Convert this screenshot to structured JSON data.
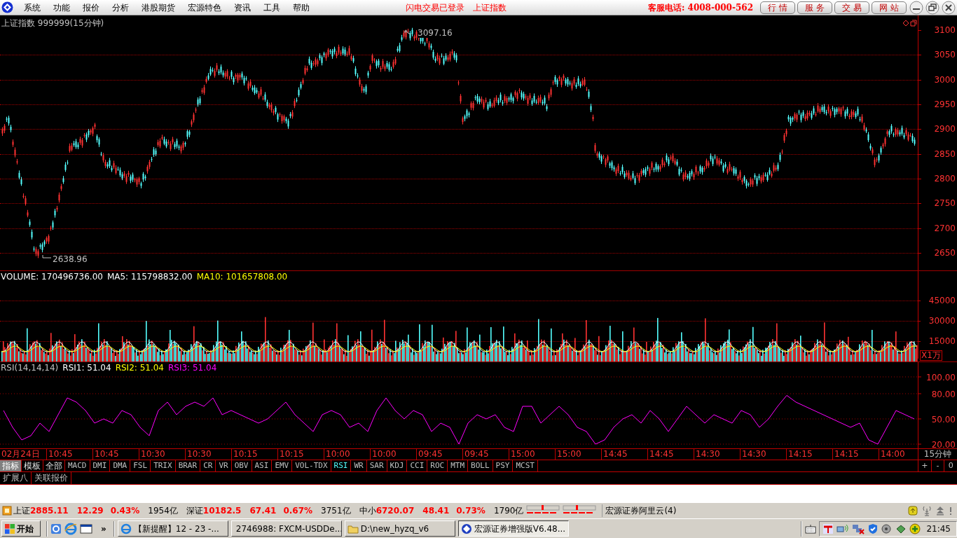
{
  "menu": {
    "items": [
      "系统",
      "功能",
      "报价",
      "分析",
      "港股期货",
      "宏源特色",
      "资讯",
      "工具",
      "帮助"
    ]
  },
  "login_status": "闪电交易已登录",
  "current_index": "上证指数",
  "hotline": "客服电话: 4008-000-562",
  "nav_buttons": [
    "行 情",
    "服 务",
    "交 易",
    "网 站"
  ],
  "price_panel": {
    "title": "上证指数 999999(15分钟)",
    "high_label": "3097.16",
    "low_label": "2638.96",
    "axis": [
      "3100",
      "3050",
      "3000",
      "2950",
      "2900",
      "2850",
      "2800",
      "2750",
      "2700",
      "2650"
    ]
  },
  "volume_panel": {
    "legend": [
      {
        "text": "VOLUME: 170496736.00",
        "color": "#ffffff"
      },
      {
        "text": "MA5: 115798832.00",
        "color": "#ffffff"
      },
      {
        "text": "MA10: 101657808.00",
        "color": "#ffff00"
      }
    ],
    "axis": [
      "45000",
      "30000",
      "15000"
    ],
    "unit": "X1万"
  },
  "rsi_panel": {
    "legend": [
      {
        "text": "RSI(14,14,14)",
        "color": "#c0c0c0"
      },
      {
        "text": "RSI1: 51.04",
        "color": "#ffffff"
      },
      {
        "text": "RSI2: 51.04",
        "color": "#ffff00"
      },
      {
        "text": "RSI3: 51.04",
        "color": "#ff00ff"
      }
    ],
    "chart_data": {
      "type": "line",
      "grid": true,
      "ylim": [
        15,
        117.5
      ],
      "yticks": [
        {
          "value": 100,
          "label": "100.00"
        },
        {
          "value": 80,
          "label": "80.00"
        },
        {
          "value": 50,
          "label": "50.00"
        },
        {
          "value": 20,
          "label": "20.00"
        }
      ],
      "series": [
        {
          "color": "#ff00ff",
          "values": [
            60,
            40,
            25,
            30,
            45,
            35,
            55,
            75,
            70,
            60,
            45,
            50,
            45,
            60,
            55,
            40,
            30,
            60,
            70,
            55,
            65,
            70,
            65,
            75,
            55,
            60,
            55,
            50,
            45,
            50,
            60,
            70,
            55,
            45,
            35,
            55,
            60,
            55,
            40,
            45,
            35,
            60,
            75,
            60,
            50,
            60,
            55,
            35,
            45,
            40,
            20,
            45,
            55,
            50,
            55,
            40,
            35,
            65,
            65,
            45,
            55,
            65,
            55,
            40,
            35,
            20,
            25,
            40,
            50,
            55,
            45,
            60,
            50,
            35,
            50,
            65,
            55,
            45,
            55,
            50,
            45,
            60,
            55,
            40,
            50,
            65,
            78,
            70,
            65,
            60,
            55,
            50,
            45,
            40,
            45,
            25,
            20,
            40,
            60,
            55,
            50
          ]
        }
      ]
    }
  },
  "time_axis": {
    "labels": [
      "02月24日",
      "10:45",
      "10:45",
      "10:30",
      "10:30",
      "10:15",
      "10:15",
      "10:00",
      "10:00",
      "09:45",
      "09:45",
      "15:00",
      "15:00",
      "14:45",
      "14:45",
      "14:30",
      "14:30",
      "14:15",
      "14:15",
      "14:00"
    ],
    "period": "15分钟"
  },
  "panel_buttons": [
    {
      "label": "指标",
      "selected": true
    },
    {
      "label": "模板",
      "selected": false
    },
    {
      "label": "全部",
      "selected": false
    }
  ],
  "indicators": [
    {
      "label": "MACD",
      "selected": false
    },
    {
      "label": "DMI",
      "selected": false
    },
    {
      "label": "DMA",
      "selected": false
    },
    {
      "label": "FSL",
      "selected": false
    },
    {
      "label": "TRIX",
      "selected": false
    },
    {
      "label": "BRAR",
      "selected": false
    },
    {
      "label": "CR",
      "selected": false
    },
    {
      "label": "VR",
      "selected": false
    },
    {
      "label": "OBV",
      "selected": false
    },
    {
      "label": "ASI",
      "selected": false
    },
    {
      "label": "EMV",
      "selected": false
    },
    {
      "label": "VOL-TDX",
      "selected": false
    },
    {
      "label": "RSI",
      "selected": true
    },
    {
      "label": "WR",
      "selected": false
    },
    {
      "label": "SAR",
      "selected": false
    },
    {
      "label": "KDJ",
      "selected": false
    },
    {
      "label": "CCI",
      "selected": false
    },
    {
      "label": "ROC",
      "selected": false
    },
    {
      "label": "MTM",
      "selected": false
    },
    {
      "label": "BOLL",
      "selected": false
    },
    {
      "label": "PSY",
      "selected": false
    },
    {
      "label": "MCST",
      "selected": false
    }
  ],
  "zoom_buttons": [
    "+",
    "-",
    "0"
  ],
  "bottom_tabs": [
    "扩展八",
    "关联报价"
  ],
  "status_bar": {
    "indices": [
      {
        "name": "上证",
        "value": "2885.11",
        "change": "12.29",
        "percent": "0.43%",
        "turnover": "1954亿"
      },
      {
        "name": "深证",
        "value": "10182.5",
        "change": "67.41",
        "percent": "0.67%",
        "turnover": "3751亿"
      },
      {
        "name": "中小",
        "value": "6720.07",
        "change": "48.41",
        "percent": "0.73%",
        "turnover": "1790亿"
      }
    ],
    "server": "宏源证券阿里云(4)"
  },
  "taskbar": {
    "start": "开始",
    "more": "»",
    "tasks": [
      {
        "label": "【新提醒】12 - 23 -...",
        "selected": false
      },
      {
        "label": "2746988: FXCM-USDDe...",
        "selected": false
      },
      {
        "label": "D:\\new_hyzq_v6",
        "selected": false
      },
      {
        "label": "宏源证券增强版V6.48...",
        "selected": true
      }
    ],
    "clock": "21:45"
  }
}
